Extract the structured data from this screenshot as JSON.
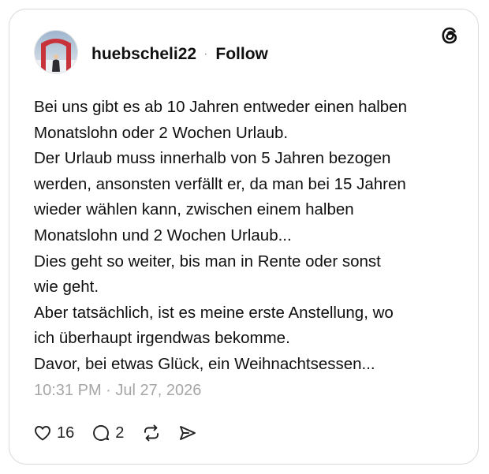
{
  "post": {
    "username": "huebscheli22",
    "separator": "·",
    "follow_label": "Follow",
    "lines": [
      "Bei uns gibt es ab 10 Jahren entweder einen halben",
      "Monatslohn oder 2 Wochen Urlaub.",
      "Der Urlaub muss innerhalb von 5 Jahren bezogen",
      "werden, ansonsten verfällt er, da man bei 15 Jahren",
      "wieder wählen kann, zwischen einem halben",
      "Monatslohn und 2 Wochen Urlaub...",
      "Dies geht so weiter, bis man in Rente oder sonst",
      "wie geht.",
      "Aber tatsächlich, ist es meine erste Anstellung, wo",
      "ich überhaupt irgendwas bekomme.",
      "Davor, bei etwas Glück, ein Weihnachtsessen..."
    ],
    "timestamp": "10:31 PM · Jul 27, 2026",
    "likes": "16",
    "replies": "2"
  },
  "icons": {
    "brand": "threads-logo-icon",
    "like": "heart-icon",
    "reply": "speech-bubble-icon",
    "repost": "repost-icon",
    "share": "send-icon"
  },
  "colors": {
    "text": "#101010",
    "muted": "#a6a6a6",
    "border": "#d9d9d9"
  }
}
